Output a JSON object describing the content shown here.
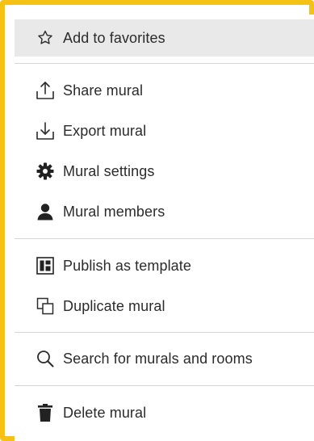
{
  "menu": {
    "items": [
      {
        "id": "add-to-favorites",
        "label": "Add to favorites",
        "icon": "star-outline-icon"
      },
      {
        "id": "share-mural",
        "label": "Share mural",
        "icon": "upload-icon"
      },
      {
        "id": "export-mural",
        "label": "Export mural",
        "icon": "download-icon"
      },
      {
        "id": "mural-settings",
        "label": "Mural settings",
        "icon": "gear-icon"
      },
      {
        "id": "mural-members",
        "label": "Mural members",
        "icon": "person-icon"
      },
      {
        "id": "publish-as-template",
        "label": "Publish as template",
        "icon": "template-icon"
      },
      {
        "id": "duplicate-mural",
        "label": "Duplicate mural",
        "icon": "duplicate-icon"
      },
      {
        "id": "search-murals-rooms",
        "label": "Search for murals and rooms",
        "icon": "search-icon"
      },
      {
        "id": "delete-mural",
        "label": "Delete mural",
        "icon": "trash-icon"
      }
    ],
    "hovered_item": "add-to-favorites"
  },
  "colors": {
    "frame_border": "#f5c211",
    "hover_background": "#e9e9e9",
    "divider": "#d6d6d6",
    "text": "#2b2b2b"
  }
}
